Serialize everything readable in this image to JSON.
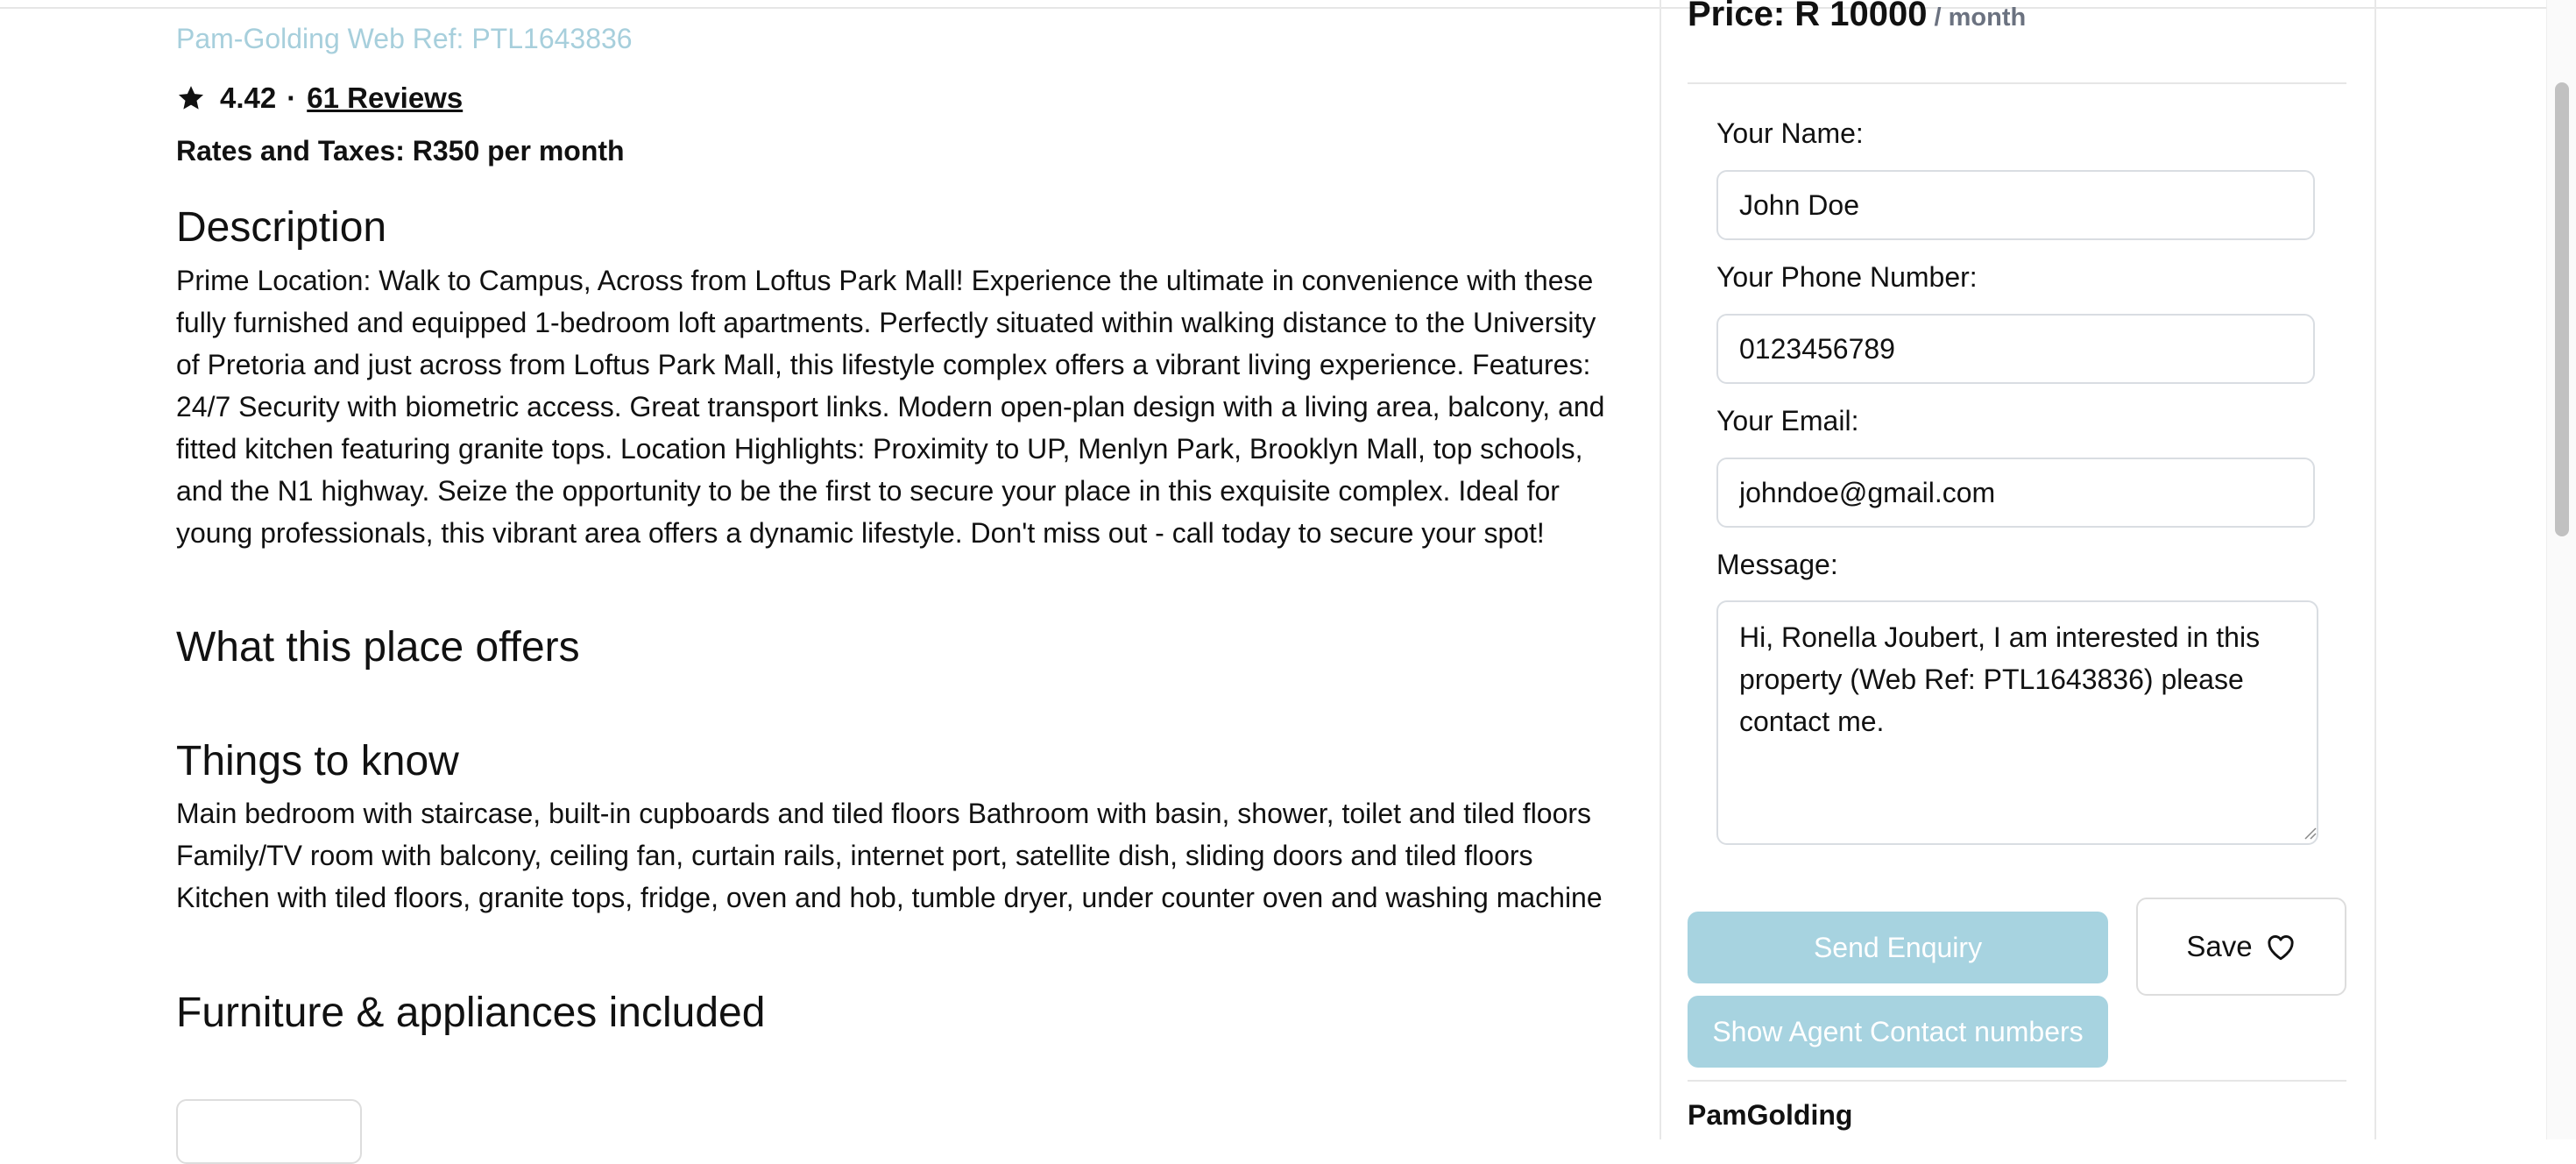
{
  "listing": {
    "web_ref": "Pam-Golding Web Ref: PTL1643836",
    "rating": "4.42",
    "rating_separator": "·",
    "reviews_link": "61 Reviews",
    "rates_taxes": "Rates and Taxes: R350 per month",
    "description_heading": "Description",
    "description_text": "Prime Location: Walk to Campus, Across from Loftus Park Mall! Experience the ultimate in convenience with these fully furnished and equipped 1-bedroom loft apartments. Perfectly situated within walking distance to the University of Pretoria and just across from Loftus Park Mall, this lifestyle complex offers a vibrant living experience. Features: 24/7 Security with biometric access. Great transport links. Modern open-plan design with a living area, balcony, and fitted kitchen featuring granite tops. Location Highlights: Proximity to UP, Menlyn Park, Brooklyn Mall, top schools, and the N1 highway. Seize the opportunity to be the first to secure your place in this exquisite complex. Ideal for young professionals, this vibrant area offers a dynamic lifestyle. Don't miss out - call today to secure your spot!",
    "offers_heading": "What this place offers",
    "know_heading": "Things to know",
    "know_text": "Main bedroom with staircase, built-in cupboards and tiled floors Bathroom with basin, shower, toilet and tiled floors Family/TV room with balcony, ceiling fan, curtain rails, internet port, satellite dish, sliding doors and tiled floors Kitchen with tiled floors, granite tops, fridge, oven and hob, tumble dryer, under counter oven and washing machine",
    "furniture_heading": "Furniture & appliances included"
  },
  "enquiry": {
    "price": "Price: R 10000",
    "price_period": "/ month",
    "name_label": "Your Name:",
    "name_value": "John Doe",
    "phone_label": "Your Phone Number:",
    "phone_value": "0123456789",
    "email_label": "Your Email:",
    "email_value": "johndoe@gmail.com",
    "message_label": "Message:",
    "message_value": "Hi, Ronella Joubert, I am interested in this property (Web Ref: PTL1643836) please contact me.",
    "send_button": "Send Enquiry",
    "save_button": "Save",
    "agent_button": "Show Agent Contact numbers",
    "agency_name": "PamGolding"
  },
  "icons": {
    "rating": "star-icon",
    "save": "heart-icon"
  },
  "colors": {
    "accent_light": "#a7d3e0",
    "web_ref": "#a7cfdc",
    "muted": "#6b7280"
  }
}
